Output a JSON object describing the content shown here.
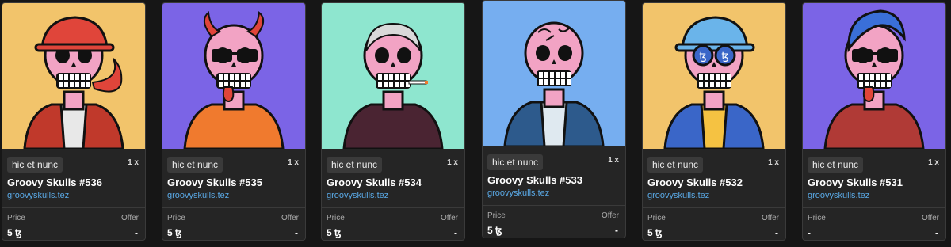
{
  "cards": [
    {
      "marketplace": "hic et nunc",
      "quantity": "1 x",
      "title": "Groovy Skulls #536",
      "creator": "groovyskulls.tez",
      "price_label": "Price",
      "offer_label": "Offer",
      "price": "5 ꜩ",
      "offer": "-",
      "bg": "#f2c46b",
      "hat": "#e0453a",
      "shirt": "#e8e8e8",
      "shirt2": "#c0392b",
      "hair": "none",
      "glasses": "none",
      "extra": "flame"
    },
    {
      "marketplace": "hic et nunc",
      "quantity": "1 x",
      "title": "Groovy Skulls #535",
      "creator": "groovyskulls.tez",
      "price_label": "Price",
      "offer_label": "Offer",
      "price": "5 ꜩ",
      "offer": "-",
      "bg": "#7b64e6",
      "hat": "horns",
      "shirt": "#f07a2e",
      "shirt2": "#f07a2e",
      "hair": "none",
      "glasses": "black",
      "extra": "tongue"
    },
    {
      "marketplace": "hic et nunc",
      "quantity": "1 x",
      "title": "Groovy Skulls #534",
      "creator": "groovyskulls.tez",
      "price_label": "Price",
      "offer_label": "Offer",
      "price": "5 ꜩ",
      "offer": "-",
      "bg": "#8ee6cf",
      "hat": "none",
      "shirt": "#4a2432",
      "shirt2": "#4a2432",
      "hair": "buzz",
      "glasses": "none",
      "extra": "cigarette"
    },
    {
      "marketplace": "hic et nunc",
      "quantity": "1 x",
      "title": "Groovy Skulls #533",
      "creator": "groovyskulls.tez",
      "price_label": "Price",
      "offer_label": "Offer",
      "price": "5 ꜩ",
      "offer": "-",
      "bg": "#76aef0",
      "hat": "none",
      "shirt": "#dfe9f0",
      "shirt2": "#2d5a8c",
      "hair": "tattoo",
      "glasses": "none",
      "extra": "none"
    },
    {
      "marketplace": "hic et nunc",
      "quantity": "1 x",
      "title": "Groovy Skulls #532",
      "creator": "groovyskulls.tez",
      "price_label": "Price",
      "offer_label": "Offer",
      "price": "5 ꜩ",
      "offer": "-",
      "bg": "#f2c46b",
      "hat": "#6ab4ea",
      "shirt": "#f5c242",
      "shirt2": "#3a66c8",
      "hair": "none",
      "glasses": "tez",
      "extra": "none"
    },
    {
      "marketplace": "hic et nunc",
      "quantity": "1 x",
      "title": "Groovy Skulls #531",
      "creator": "groovyskulls.tez",
      "price_label": "Price",
      "offer_label": "Offer",
      "price": "-",
      "offer": "-",
      "bg": "#7b64e6",
      "hat": "mohawk",
      "shirt": "#b03a36",
      "shirt2": "#b03a36",
      "hair": "none",
      "glasses": "black",
      "extra": "tongue"
    }
  ]
}
